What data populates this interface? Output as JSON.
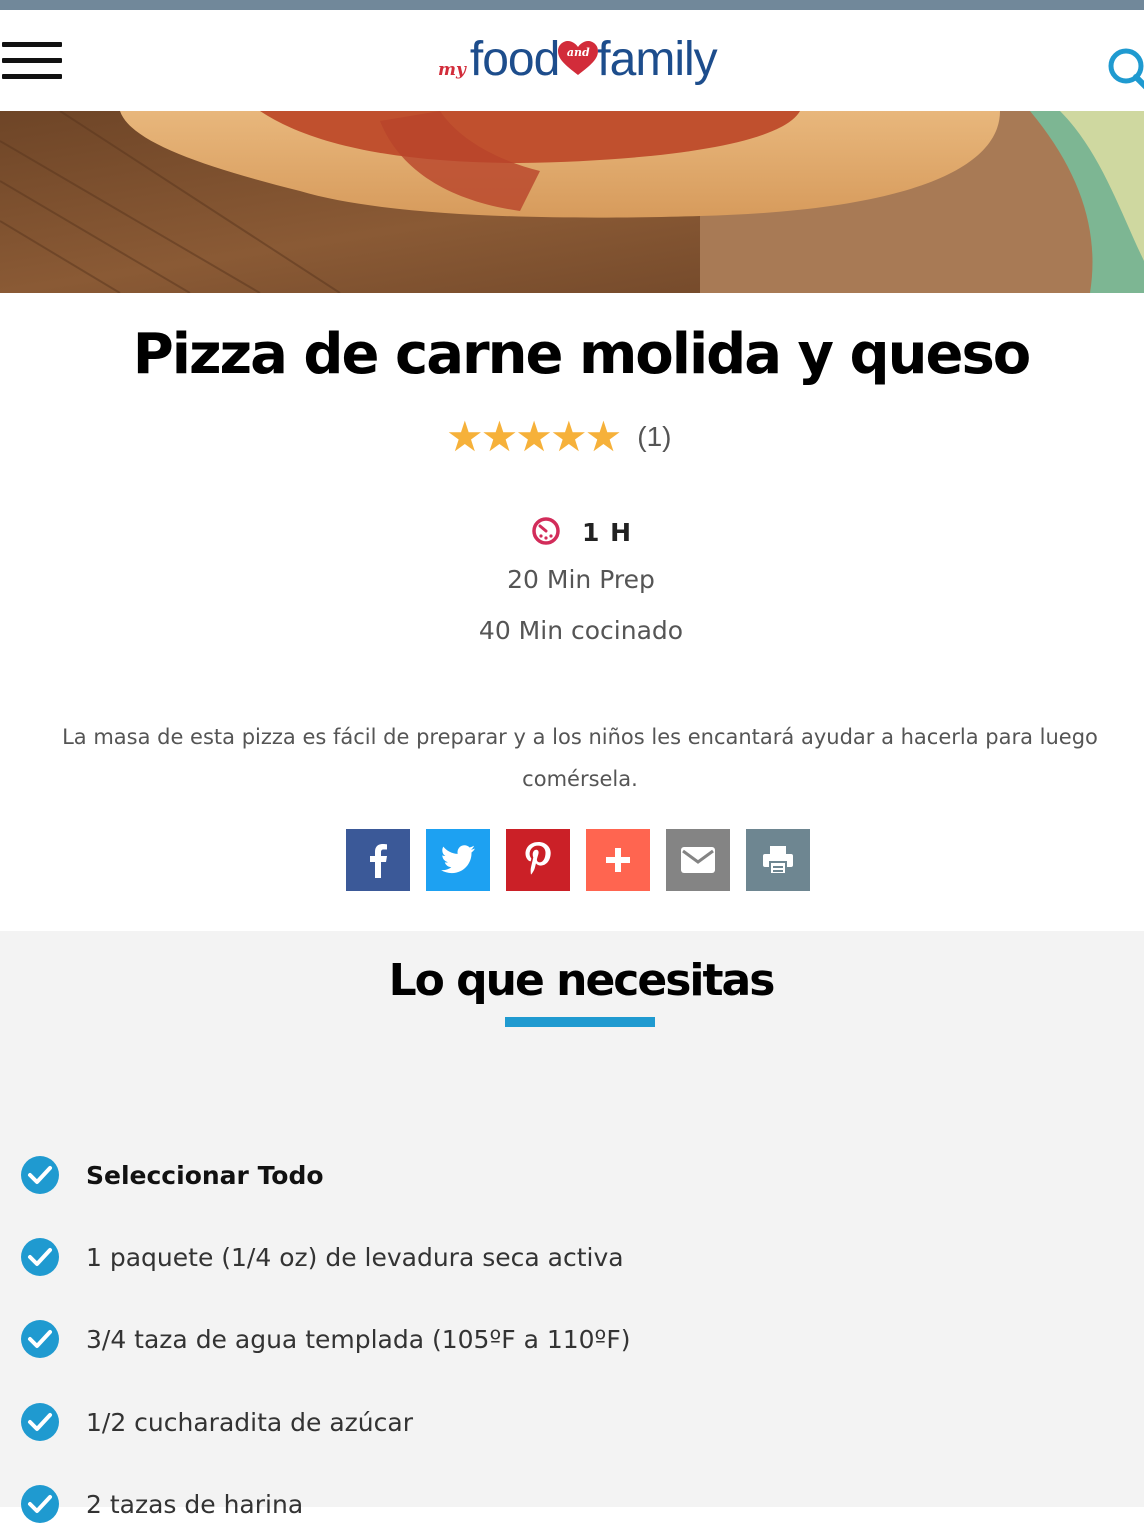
{
  "header": {
    "logo": {
      "my": "my",
      "food": "food",
      "and": "and",
      "family": "family"
    },
    "menu_icon": "hamburger-menu-icon",
    "search_icon": "search-icon"
  },
  "recipe": {
    "title": "Pizza de carne molida y queso",
    "rating": {
      "stars": 5,
      "count": "(1)"
    },
    "total_time": "1 H",
    "prep_time": "20 Min Prep",
    "cook_time": "40 Min cocinado",
    "description_line1": "La masa de esta pizza es fácil de preparar y a los niños les encantará ayudar a hacerla para luego",
    "description_line2": "comérsela."
  },
  "share": [
    {
      "name": "facebook",
      "color": "#3b5998"
    },
    {
      "name": "twitter",
      "color": "#1da1f2"
    },
    {
      "name": "pinterest",
      "color": "#cb2027"
    },
    {
      "name": "more",
      "color": "#ff6550"
    },
    {
      "name": "email",
      "color": "#848484"
    },
    {
      "name": "print",
      "color": "#6e8691"
    }
  ],
  "ingredients": {
    "heading": "Lo que necesitas",
    "select_all": "Seleccionar Todo",
    "items": [
      "1 paquete (1/4 oz) de levadura seca activa",
      "3/4 taza de agua templada (105ºF a 110ºF)",
      "1/2 cucharadita de azúcar",
      "2 tazas de harina"
    ]
  },
  "colors": {
    "accent_blue": "#1f9ad0",
    "star": "#f6b13a",
    "brand_red": "#d22c3a",
    "brand_blue": "#1d4d8c"
  }
}
